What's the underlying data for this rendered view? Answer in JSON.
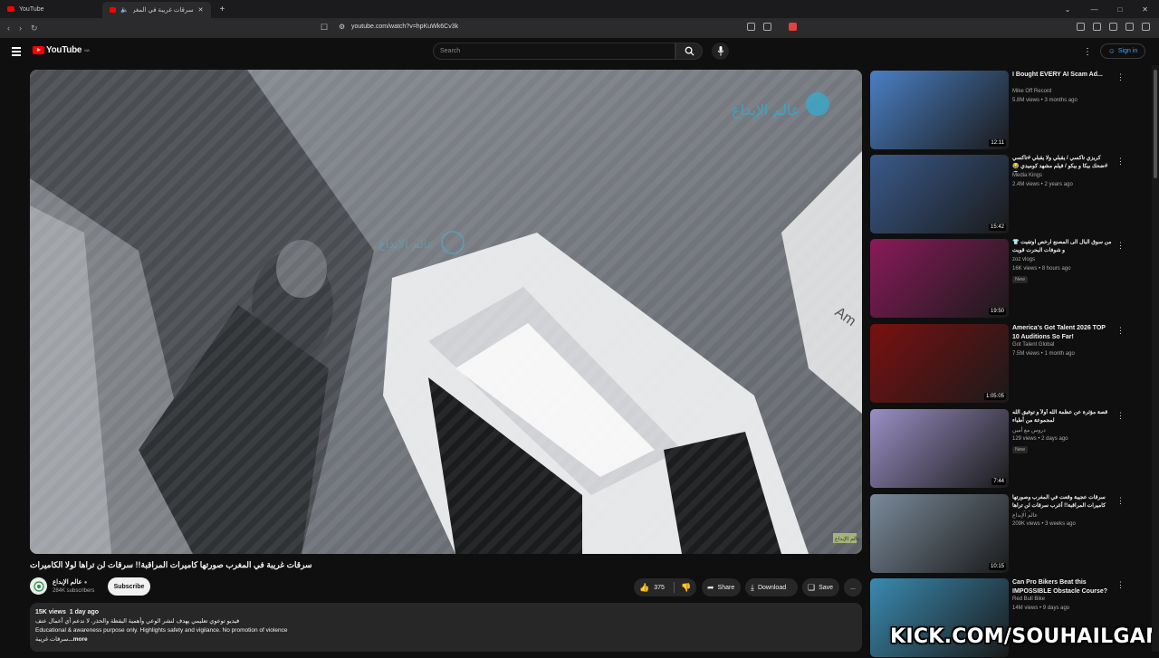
{
  "browser": {
    "tabs": [
      {
        "label": "YouTube",
        "active": false
      },
      {
        "label": "سرقات غريبة في المغرب صور...",
        "active": true
      }
    ],
    "new_tab": "+",
    "url": "youtube.com/watch?v=hpKuWk6Cv3k"
  },
  "header": {
    "logo": "YouTube",
    "logo_region": "MA",
    "search_placeholder": "Search",
    "signin_label": "Sign in"
  },
  "video": {
    "title": "سرقات غريبة في المغرب صورتها كاميرات المراقبة!! سرقات لن تراها لولا الكاميرات",
    "overlay_logo_text": "عالم الإبداع",
    "overlay_center_text": "عالم الإبداع",
    "overlay_car_text": "Am",
    "corner_tag": "عالم الإبداع"
  },
  "channel": {
    "name": "عالم الإبداع",
    "subscribers": "284K subscribers",
    "subscribe_label": "Subscribe"
  },
  "actions": {
    "likes": "375",
    "share_label": "Share",
    "download_label": "Download",
    "save_label": "Save",
    "more_label": "..."
  },
  "description": {
    "views": "15K views",
    "age": "1 day ago",
    "line1": "فيديو توعوي تعليمي يهدف لنشر الوعي وأهمية اليقظة والحذر. لا ندعم أي أعمال عنف",
    "line2": "Educational & awareness purpose only. Highlights safety and vigilance. No promotion of violence",
    "line3": "سرقات غريبة",
    "more": "...more"
  },
  "recommendations": [
    {
      "title": "I Bought EVERY AI Scam Ad...",
      "channel": "Mike Off Record",
      "meta": "5.8M views • 3 months ago",
      "duration": "12:11",
      "badge": "",
      "thumb_color": "#4a7fc4"
    },
    {
      "title": "كريزي تاكسي / يقبلي ولا يقبلي #تاكسي #ضحك بيكا و بيكو / فيلم مشهد كوميدي 😂😂",
      "channel": "Media Kings",
      "meta": "2.4M views • 2 years ago",
      "duration": "15:42",
      "badge": "",
      "thumb_color": "#3a5a8a"
    },
    {
      "title": "من سوق البال الى المصنع ارخص اوتفيت 👕 و شوفات البحرت قويت",
      "channel": "zoz vlogs",
      "meta": "16K views • 8 hours ago",
      "duration": "19:50",
      "badge": "New",
      "thumb_color": "#8a1a5a"
    },
    {
      "title": "America's Got Talent 2026 TOP 10 Auditions So Far!",
      "channel": "Got Talent Global",
      "meta": "7.5M views • 1 month ago",
      "duration": "1:05:05",
      "badge": "",
      "thumb_color": "#7a1010"
    },
    {
      "title": "قصة مؤثرة عن عظمة الله أولاً و توفيق الله لمجموعة من أطباء",
      "channel": "دروس مع أمين",
      "meta": "129 views • 2 days ago",
      "duration": "7:44",
      "badge": "New",
      "thumb_color": "#9a8fc4"
    },
    {
      "title": "سرقات عجيبة وقعت في المغرب وصورتها كاميرات المراقبة!! أغرب سرقات لن تراها لولا مرة",
      "channel": "عالم الإبداع",
      "meta": "209K views • 3 weeks ago",
      "duration": "10:15",
      "badge": "",
      "thumb_color": "#7a8a9a"
    },
    {
      "title": "Can Pro Bikers Beat this IMPOSSIBLE Obstacle Course?",
      "channel": "Red Bull Bike",
      "meta": "14M views • 9 days ago",
      "duration": "",
      "badge": "",
      "thumb_color": "#3a8ab0"
    }
  ],
  "watermark": "KICK.COM/SOUHAILGAMING"
}
